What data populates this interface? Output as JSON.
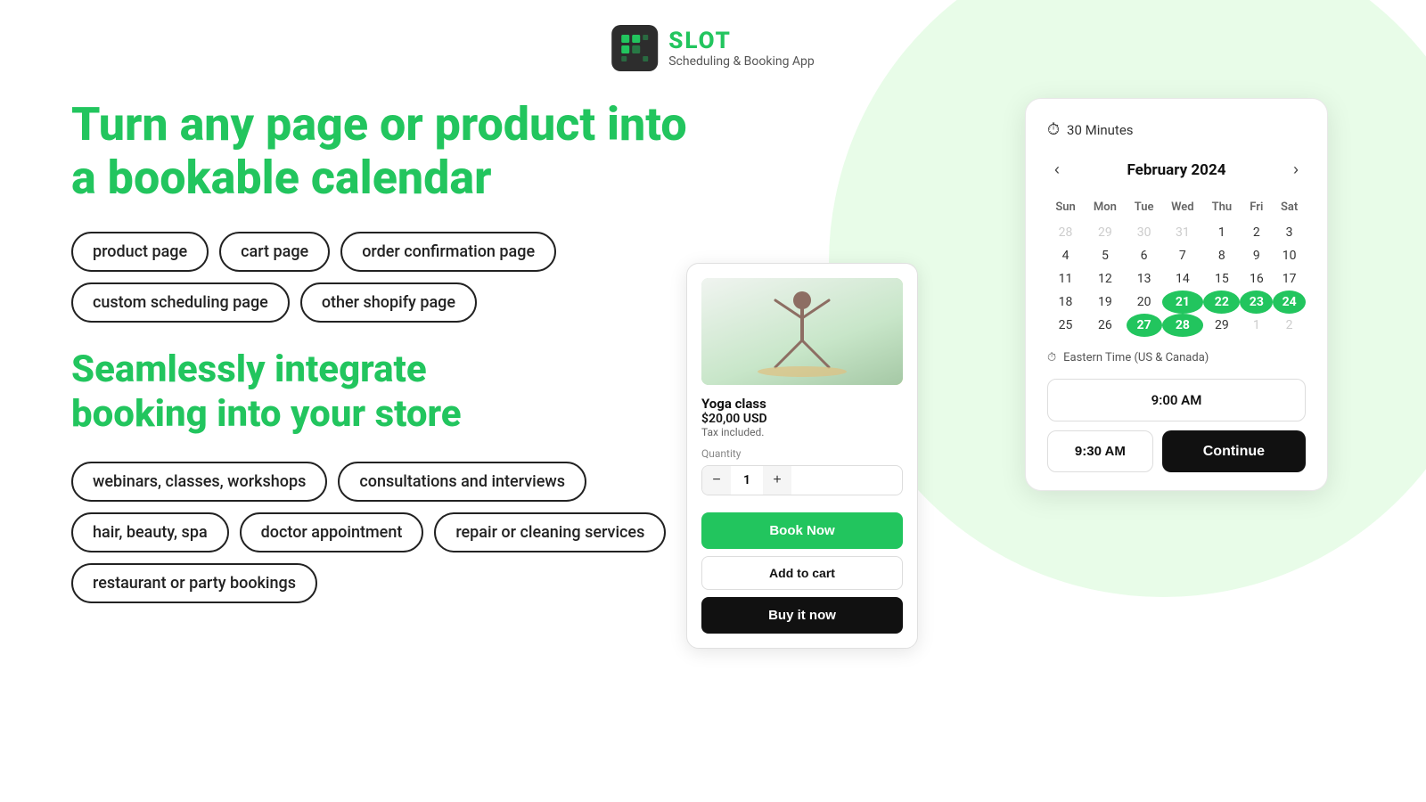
{
  "app": {
    "logo_text": "SLOT",
    "tagline": "Scheduling & Booking App"
  },
  "hero": {
    "headline": "Turn any page or product into\na bookable calendar",
    "tags_row1": [
      "product page",
      "cart page",
      "order confirmation page"
    ],
    "tags_row2": [
      "custom scheduling page",
      "other shopify page"
    ],
    "subheadline": "Seamlessly integrate\nbooking into your store",
    "use_cases": [
      "webinars, classes, workshops",
      "consultations and interviews",
      "hair, beauty, spa",
      "doctor appointment",
      "repair or cleaning services",
      "restaurant or party bookings"
    ]
  },
  "product_card": {
    "name": "Yoga class",
    "price": "$20,00 USD",
    "tax": "Tax included.",
    "quantity_label": "Quantity",
    "quantity_value": "1",
    "btn_book": "Book Now",
    "btn_add_cart": "Add to cart",
    "btn_buy": "Buy it now"
  },
  "calendar": {
    "duration": "30 Minutes",
    "month": "February 2024",
    "prev_icon": "‹",
    "next_icon": "›",
    "days_of_week": [
      "Sun",
      "Mon",
      "Tue",
      "Wed",
      "Thu",
      "Fri",
      "Sat"
    ],
    "weeks": [
      [
        {
          "num": "28",
          "type": "other-month"
        },
        {
          "num": "29",
          "type": "other-month"
        },
        {
          "num": "30",
          "type": "other-month"
        },
        {
          "num": "31",
          "type": "other-month"
        },
        {
          "num": "1",
          "type": "normal"
        },
        {
          "num": "2",
          "type": "normal"
        },
        {
          "num": "3",
          "type": "normal"
        }
      ],
      [
        {
          "num": "4",
          "type": "normal"
        },
        {
          "num": "5",
          "type": "normal"
        },
        {
          "num": "6",
          "type": "normal"
        },
        {
          "num": "7",
          "type": "normal"
        },
        {
          "num": "8",
          "type": "normal"
        },
        {
          "num": "9",
          "type": "normal"
        },
        {
          "num": "10",
          "type": "normal"
        }
      ],
      [
        {
          "num": "11",
          "type": "normal"
        },
        {
          "num": "12",
          "type": "normal"
        },
        {
          "num": "13",
          "type": "normal"
        },
        {
          "num": "14",
          "type": "normal"
        },
        {
          "num": "15",
          "type": "normal"
        },
        {
          "num": "16",
          "type": "normal"
        },
        {
          "num": "17",
          "type": "normal"
        }
      ],
      [
        {
          "num": "18",
          "type": "normal"
        },
        {
          "num": "19",
          "type": "normal"
        },
        {
          "num": "20",
          "type": "normal"
        },
        {
          "num": "21",
          "type": "selected"
        },
        {
          "num": "22",
          "type": "selected"
        },
        {
          "num": "23",
          "type": "selected"
        },
        {
          "num": "24",
          "type": "selected"
        }
      ],
      [
        {
          "num": "25",
          "type": "normal"
        },
        {
          "num": "26",
          "type": "normal"
        },
        {
          "num": "27",
          "type": "selected"
        },
        {
          "num": "28",
          "type": "selected"
        },
        {
          "num": "29",
          "type": "normal"
        },
        {
          "num": "1",
          "type": "other-month"
        },
        {
          "num": "2",
          "type": "other-month"
        }
      ]
    ],
    "timezone_label": "Eastern Time (US & Canada)",
    "time_slots": [
      "9:00 AM",
      "9:30 AM"
    ],
    "btn_continue": "Continue"
  }
}
